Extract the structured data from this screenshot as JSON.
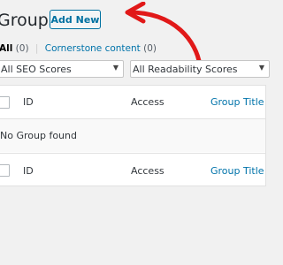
{
  "header": {
    "title": "Groups",
    "add_new_label": "Add New"
  },
  "filters_links": {
    "all_label": "All",
    "all_count": "(0)",
    "separator": "|",
    "cornerstone_label": "Cornerstone content",
    "cornerstone_count": "(0)"
  },
  "selects": {
    "seo_scores": "All SEO Scores",
    "readability_scores": "All Readability Scores"
  },
  "table": {
    "columns": [
      "ID",
      "Access",
      "Group Title"
    ],
    "empty_message": "No Group found"
  },
  "annotation": {
    "color": "#e11919"
  },
  "colors": {
    "link": "#0073aa",
    "button_border": "#0071a1"
  }
}
